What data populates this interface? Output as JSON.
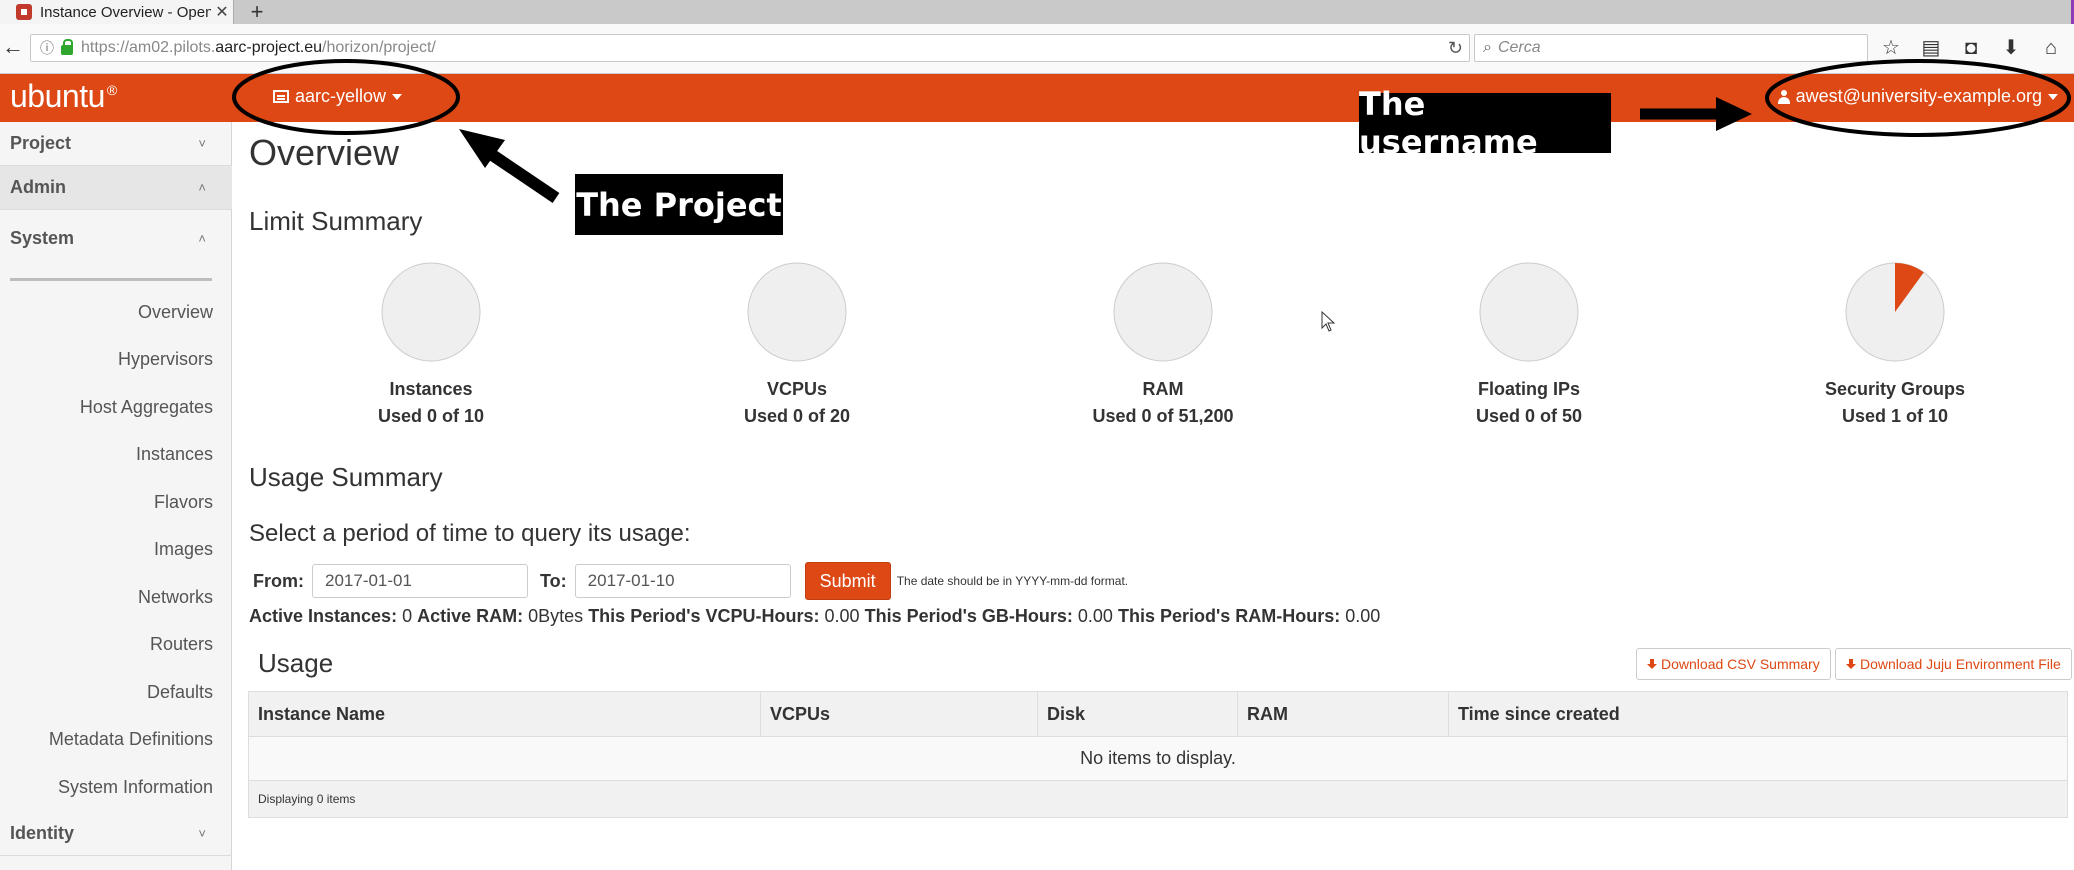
{
  "browser": {
    "tab_title": "Instance Overview - Open...",
    "tab_close": "✕",
    "new_tab": "+",
    "url_prefix": "https://am02.pilots.",
    "url_domain": "aarc-project.eu",
    "url_path": "/horizon/project/",
    "search_placeholder": "Cerca"
  },
  "header": {
    "brand": "ubuntu",
    "brand_mark": "®",
    "project": "aarc-yellow",
    "username": "awest@university-example.org",
    "accent_color": "#dd4814"
  },
  "sidebar": {
    "project": "Project",
    "admin": "Admin",
    "system": "System",
    "items": [
      "Overview",
      "Hypervisors",
      "Host Aggregates",
      "Instances",
      "Flavors",
      "Images",
      "Networks",
      "Routers",
      "Defaults",
      "Metadata Definitions",
      "System Information"
    ],
    "identity": "Identity"
  },
  "main": {
    "title": "Overview",
    "limit_summary": "Limit Summary",
    "limits": [
      {
        "name": "Instances",
        "used_text": "Used 0 of 10",
        "used": 0,
        "total": 10
      },
      {
        "name": "VCPUs",
        "used_text": "Used 0 of 20",
        "used": 0,
        "total": 20
      },
      {
        "name": "RAM",
        "used_text": "Used 0 of 51,200",
        "used": 0,
        "total": 51200
      },
      {
        "name": "Floating IPs",
        "used_text": "Used 0 of 50",
        "used": 0,
        "total": 50
      },
      {
        "name": "Security Groups",
        "used_text": "Used 1 of 10",
        "used": 1,
        "total": 10
      }
    ],
    "usage_summary": "Usage Summary",
    "period_prompt": "Select a period of time to query its usage:",
    "from_label": "From:",
    "from_value": "2017-01-01",
    "to_label": "To:",
    "to_value": "2017-01-10",
    "submit": "Submit",
    "date_hint": "The date should be in YYYY-mm-dd format.",
    "stats": {
      "active_instances_label": "Active Instances:",
      "active_instances": "0",
      "active_ram_label": "Active RAM:",
      "active_ram": "0Bytes",
      "vcpu_hours_label": "This Period's VCPU-Hours:",
      "vcpu_hours": "0.00",
      "gb_hours_label": "This Period's GB-Hours:",
      "gb_hours": "0.00",
      "ram_hours_label": "This Period's RAM-Hours:",
      "ram_hours": "0.00"
    },
    "usage_title": "Usage",
    "download_csv": "Download CSV Summary",
    "download_juju": "Download Juju Environment File",
    "table": {
      "columns": [
        "Instance Name",
        "VCPUs",
        "Disk",
        "RAM",
        "Time since created"
      ],
      "empty": "No items to display.",
      "footer": "Displaying 0 items"
    }
  },
  "annotations": {
    "project_label": "The Project",
    "username_label": "The username"
  }
}
